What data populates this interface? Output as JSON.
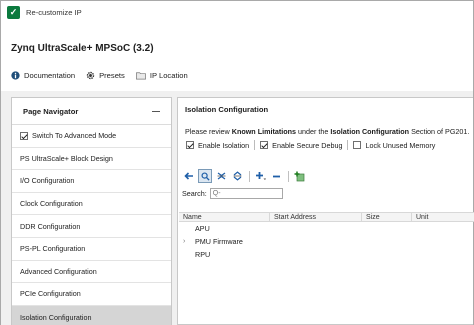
{
  "window": {
    "title": "Re-customize IP"
  },
  "header": {
    "ip_name": "Zynq UltraScale+ MPSoC (3.2)",
    "links": [
      {
        "label": "Documentation",
        "icon": "info-icon"
      },
      {
        "label": "Presets",
        "icon": "gear-icon"
      },
      {
        "label": "IP Location",
        "icon": "folder-icon"
      }
    ]
  },
  "navigator": {
    "title": "Page Navigator",
    "switch_mode": {
      "label": "Switch To Advanced Mode",
      "checked": true
    },
    "items": [
      {
        "label": "PS UltraScale+ Block Design",
        "selected": false
      },
      {
        "label": "I/O Configuration",
        "selected": false
      },
      {
        "label": "Clock Configuration",
        "selected": false
      },
      {
        "label": "DDR Configuration",
        "selected": false
      },
      {
        "label": "PS-PL Configuration",
        "selected": false
      },
      {
        "label": "Advanced Configuration",
        "selected": false
      },
      {
        "label": "PCIe Configuration",
        "selected": false
      },
      {
        "label": "Isolation Configuration",
        "selected": true
      }
    ]
  },
  "content": {
    "title": "Isolation Configuration",
    "review": {
      "prefix": "Please review ",
      "bold1": "Known Limitations",
      "mid": " under the ",
      "bold2": "Isolation Configuration",
      "suffix": " Section of PG201."
    },
    "options": [
      {
        "label": "Enable Isolation",
        "checked": true
      },
      {
        "label": "Enable Secure Debug",
        "checked": true
      },
      {
        "label": "Lock Unused Memory",
        "checked": false
      }
    ],
    "toolbar": [
      "back-arrow-icon",
      "search-icon",
      "collapse-all-icon",
      "expand-all-icon",
      "add-icon",
      "remove-icon",
      "add-config-icon"
    ],
    "search": {
      "label": "Search:",
      "placeholder": "Q-"
    },
    "table": {
      "columns": [
        "Name",
        "Start Address",
        "Size",
        "Unit"
      ],
      "rows": [
        {
          "name": "APU",
          "expandable": false
        },
        {
          "name": "PMU Firmware",
          "expandable": true
        },
        {
          "name": "RPU",
          "expandable": false
        }
      ]
    }
  }
}
